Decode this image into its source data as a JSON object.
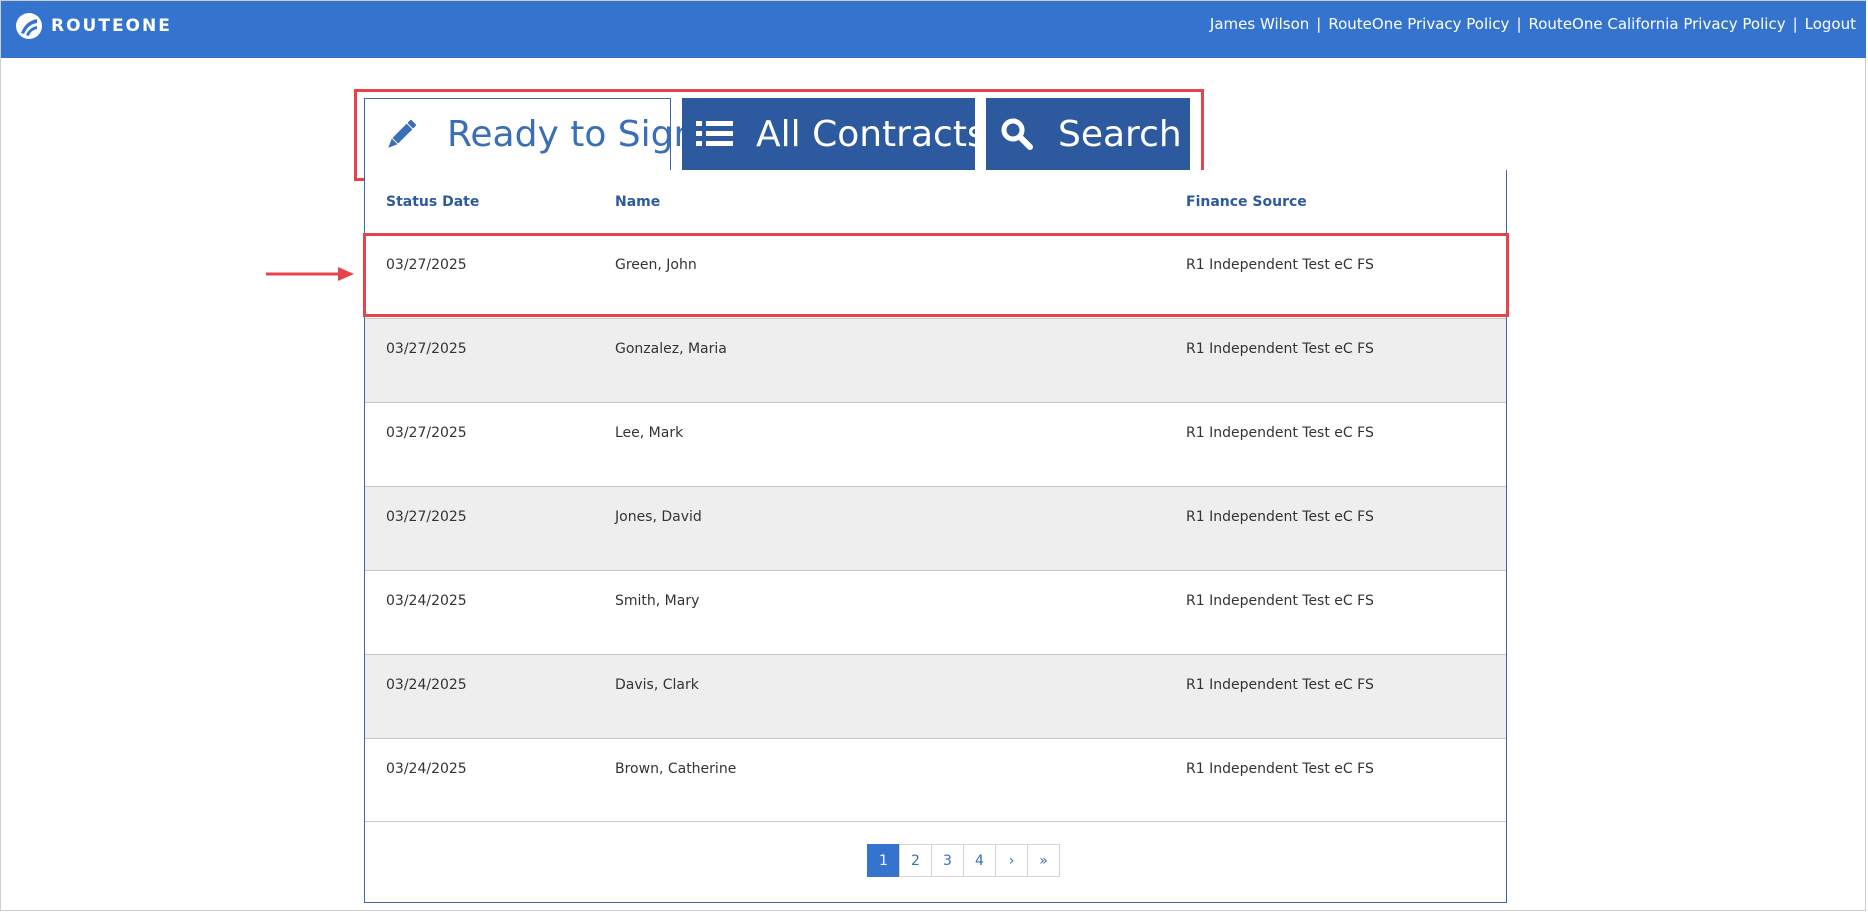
{
  "header": {
    "brand": "ROUTEONE",
    "user_name": "James Wilson",
    "separator": "|",
    "links": [
      {
        "label": "RouteOne Privacy Policy"
      },
      {
        "label": "RouteOne California Privacy Policy"
      },
      {
        "label": "Logout"
      }
    ]
  },
  "tabs": [
    {
      "label": "Ready to Sign",
      "icon": "pencil-icon",
      "active": true
    },
    {
      "label": "All Contracts",
      "icon": "list-icon",
      "active": false
    },
    {
      "label": "Search",
      "icon": "search-icon",
      "active": false
    }
  ],
  "table": {
    "columns": [
      "Status Date",
      "Name",
      "Finance Source"
    ],
    "rows": [
      {
        "date": "03/27/2025",
        "name": "Green, John",
        "source": "R1 Independent Test eC FS"
      },
      {
        "date": "03/27/2025",
        "name": "Gonzalez, Maria",
        "source": "R1 Independent Test eC FS"
      },
      {
        "date": "03/27/2025",
        "name": "Lee, Mark",
        "source": "R1 Independent Test eC FS"
      },
      {
        "date": "03/27/2025",
        "name": "Jones, David",
        "source": "R1 Independent Test eC FS"
      },
      {
        "date": "03/24/2025",
        "name": "Smith, Mary",
        "source": "R1 Independent Test eC FS"
      },
      {
        "date": "03/24/2025",
        "name": "Davis, Clark",
        "source": "R1 Independent Test eC FS"
      },
      {
        "date": "03/24/2025",
        "name": "Brown, Catherine",
        "source": "R1 Independent Test eC FS"
      }
    ]
  },
  "pagination": {
    "pages": [
      "1",
      "2",
      "3",
      "4"
    ],
    "current": "1",
    "next": "›",
    "last": "»"
  },
  "colors": {
    "header_bg": "#3474cf",
    "tab_inactive_bg": "#2d5a9e",
    "accent_text": "#3a6fb5",
    "highlight": "#e5454a",
    "row_shade": "#eeeeee"
  }
}
